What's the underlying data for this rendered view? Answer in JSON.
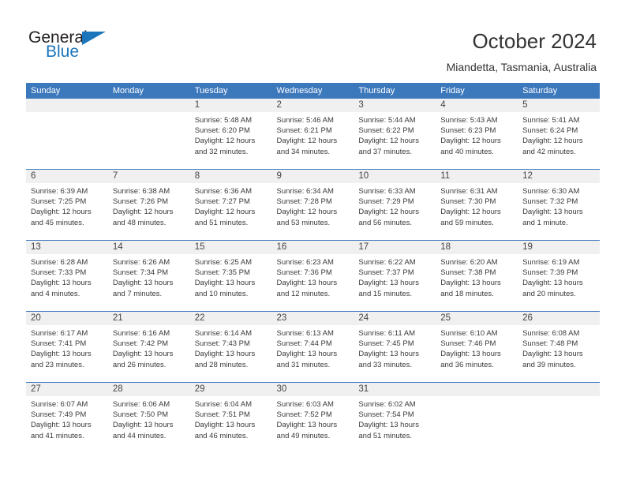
{
  "brand": {
    "name_part1": "General",
    "name_part2": "Blue",
    "logo_icon": "triangle-icon",
    "color_primary": "#1b75bb",
    "color_text": "#231f20"
  },
  "header": {
    "title": "October 2024",
    "subtitle": "Miandetta, Tasmania, Australia"
  },
  "calendar": {
    "header_color": "#3c78bc",
    "daynum_band_color": "#f0f0f0",
    "weekday_headers": [
      "Sunday",
      "Monday",
      "Tuesday",
      "Wednesday",
      "Thursday",
      "Friday",
      "Saturday"
    ],
    "weeks": [
      [
        {
          "day": "",
          "empty": true,
          "sunrise": "",
          "sunset": "",
          "daylight_line1": "",
          "daylight_line2": ""
        },
        {
          "day": "",
          "empty": true,
          "sunrise": "",
          "sunset": "",
          "daylight_line1": "",
          "daylight_line2": ""
        },
        {
          "day": "1",
          "empty": false,
          "sunrise": "Sunrise: 5:48 AM",
          "sunset": "Sunset: 6:20 PM",
          "daylight_line1": "Daylight: 12 hours",
          "daylight_line2": "and 32 minutes."
        },
        {
          "day": "2",
          "empty": false,
          "sunrise": "Sunrise: 5:46 AM",
          "sunset": "Sunset: 6:21 PM",
          "daylight_line1": "Daylight: 12 hours",
          "daylight_line2": "and 34 minutes."
        },
        {
          "day": "3",
          "empty": false,
          "sunrise": "Sunrise: 5:44 AM",
          "sunset": "Sunset: 6:22 PM",
          "daylight_line1": "Daylight: 12 hours",
          "daylight_line2": "and 37 minutes."
        },
        {
          "day": "4",
          "empty": false,
          "sunrise": "Sunrise: 5:43 AM",
          "sunset": "Sunset: 6:23 PM",
          "daylight_line1": "Daylight: 12 hours",
          "daylight_line2": "and 40 minutes."
        },
        {
          "day": "5",
          "empty": false,
          "sunrise": "Sunrise: 5:41 AM",
          "sunset": "Sunset: 6:24 PM",
          "daylight_line1": "Daylight: 12 hours",
          "daylight_line2": "and 42 minutes."
        }
      ],
      [
        {
          "day": "6",
          "empty": false,
          "sunrise": "Sunrise: 6:39 AM",
          "sunset": "Sunset: 7:25 PM",
          "daylight_line1": "Daylight: 12 hours",
          "daylight_line2": "and 45 minutes."
        },
        {
          "day": "7",
          "empty": false,
          "sunrise": "Sunrise: 6:38 AM",
          "sunset": "Sunset: 7:26 PM",
          "daylight_line1": "Daylight: 12 hours",
          "daylight_line2": "and 48 minutes."
        },
        {
          "day": "8",
          "empty": false,
          "sunrise": "Sunrise: 6:36 AM",
          "sunset": "Sunset: 7:27 PM",
          "daylight_line1": "Daylight: 12 hours",
          "daylight_line2": "and 51 minutes."
        },
        {
          "day": "9",
          "empty": false,
          "sunrise": "Sunrise: 6:34 AM",
          "sunset": "Sunset: 7:28 PM",
          "daylight_line1": "Daylight: 12 hours",
          "daylight_line2": "and 53 minutes."
        },
        {
          "day": "10",
          "empty": false,
          "sunrise": "Sunrise: 6:33 AM",
          "sunset": "Sunset: 7:29 PM",
          "daylight_line1": "Daylight: 12 hours",
          "daylight_line2": "and 56 minutes."
        },
        {
          "day": "11",
          "empty": false,
          "sunrise": "Sunrise: 6:31 AM",
          "sunset": "Sunset: 7:30 PM",
          "daylight_line1": "Daylight: 12 hours",
          "daylight_line2": "and 59 minutes."
        },
        {
          "day": "12",
          "empty": false,
          "sunrise": "Sunrise: 6:30 AM",
          "sunset": "Sunset: 7:32 PM",
          "daylight_line1": "Daylight: 13 hours",
          "daylight_line2": "and 1 minute."
        }
      ],
      [
        {
          "day": "13",
          "empty": false,
          "sunrise": "Sunrise: 6:28 AM",
          "sunset": "Sunset: 7:33 PM",
          "daylight_line1": "Daylight: 13 hours",
          "daylight_line2": "and 4 minutes."
        },
        {
          "day": "14",
          "empty": false,
          "sunrise": "Sunrise: 6:26 AM",
          "sunset": "Sunset: 7:34 PM",
          "daylight_line1": "Daylight: 13 hours",
          "daylight_line2": "and 7 minutes."
        },
        {
          "day": "15",
          "empty": false,
          "sunrise": "Sunrise: 6:25 AM",
          "sunset": "Sunset: 7:35 PM",
          "daylight_line1": "Daylight: 13 hours",
          "daylight_line2": "and 10 minutes."
        },
        {
          "day": "16",
          "empty": false,
          "sunrise": "Sunrise: 6:23 AM",
          "sunset": "Sunset: 7:36 PM",
          "daylight_line1": "Daylight: 13 hours",
          "daylight_line2": "and 12 minutes."
        },
        {
          "day": "17",
          "empty": false,
          "sunrise": "Sunrise: 6:22 AM",
          "sunset": "Sunset: 7:37 PM",
          "daylight_line1": "Daylight: 13 hours",
          "daylight_line2": "and 15 minutes."
        },
        {
          "day": "18",
          "empty": false,
          "sunrise": "Sunrise: 6:20 AM",
          "sunset": "Sunset: 7:38 PM",
          "daylight_line1": "Daylight: 13 hours",
          "daylight_line2": "and 18 minutes."
        },
        {
          "day": "19",
          "empty": false,
          "sunrise": "Sunrise: 6:19 AM",
          "sunset": "Sunset: 7:39 PM",
          "daylight_line1": "Daylight: 13 hours",
          "daylight_line2": "and 20 minutes."
        }
      ],
      [
        {
          "day": "20",
          "empty": false,
          "sunrise": "Sunrise: 6:17 AM",
          "sunset": "Sunset: 7:41 PM",
          "daylight_line1": "Daylight: 13 hours",
          "daylight_line2": "and 23 minutes."
        },
        {
          "day": "21",
          "empty": false,
          "sunrise": "Sunrise: 6:16 AM",
          "sunset": "Sunset: 7:42 PM",
          "daylight_line1": "Daylight: 13 hours",
          "daylight_line2": "and 26 minutes."
        },
        {
          "day": "22",
          "empty": false,
          "sunrise": "Sunrise: 6:14 AM",
          "sunset": "Sunset: 7:43 PM",
          "daylight_line1": "Daylight: 13 hours",
          "daylight_line2": "and 28 minutes."
        },
        {
          "day": "23",
          "empty": false,
          "sunrise": "Sunrise: 6:13 AM",
          "sunset": "Sunset: 7:44 PM",
          "daylight_line1": "Daylight: 13 hours",
          "daylight_line2": "and 31 minutes."
        },
        {
          "day": "24",
          "empty": false,
          "sunrise": "Sunrise: 6:11 AM",
          "sunset": "Sunset: 7:45 PM",
          "daylight_line1": "Daylight: 13 hours",
          "daylight_line2": "and 33 minutes."
        },
        {
          "day": "25",
          "empty": false,
          "sunrise": "Sunrise: 6:10 AM",
          "sunset": "Sunset: 7:46 PM",
          "daylight_line1": "Daylight: 13 hours",
          "daylight_line2": "and 36 minutes."
        },
        {
          "day": "26",
          "empty": false,
          "sunrise": "Sunrise: 6:08 AM",
          "sunset": "Sunset: 7:48 PM",
          "daylight_line1": "Daylight: 13 hours",
          "daylight_line2": "and 39 minutes."
        }
      ],
      [
        {
          "day": "27",
          "empty": false,
          "sunrise": "Sunrise: 6:07 AM",
          "sunset": "Sunset: 7:49 PM",
          "daylight_line1": "Daylight: 13 hours",
          "daylight_line2": "and 41 minutes."
        },
        {
          "day": "28",
          "empty": false,
          "sunrise": "Sunrise: 6:06 AM",
          "sunset": "Sunset: 7:50 PM",
          "daylight_line1": "Daylight: 13 hours",
          "daylight_line2": "and 44 minutes."
        },
        {
          "day": "29",
          "empty": false,
          "sunrise": "Sunrise: 6:04 AM",
          "sunset": "Sunset: 7:51 PM",
          "daylight_line1": "Daylight: 13 hours",
          "daylight_line2": "and 46 minutes."
        },
        {
          "day": "30",
          "empty": false,
          "sunrise": "Sunrise: 6:03 AM",
          "sunset": "Sunset: 7:52 PM",
          "daylight_line1": "Daylight: 13 hours",
          "daylight_line2": "and 49 minutes."
        },
        {
          "day": "31",
          "empty": false,
          "sunrise": "Sunrise: 6:02 AM",
          "sunset": "Sunset: 7:54 PM",
          "daylight_line1": "Daylight: 13 hours",
          "daylight_line2": "and 51 minutes."
        },
        {
          "day": "",
          "empty": true,
          "sunrise": "",
          "sunset": "",
          "daylight_line1": "",
          "daylight_line2": ""
        },
        {
          "day": "",
          "empty": true,
          "sunrise": "",
          "sunset": "",
          "daylight_line1": "",
          "daylight_line2": ""
        }
      ]
    ]
  }
}
